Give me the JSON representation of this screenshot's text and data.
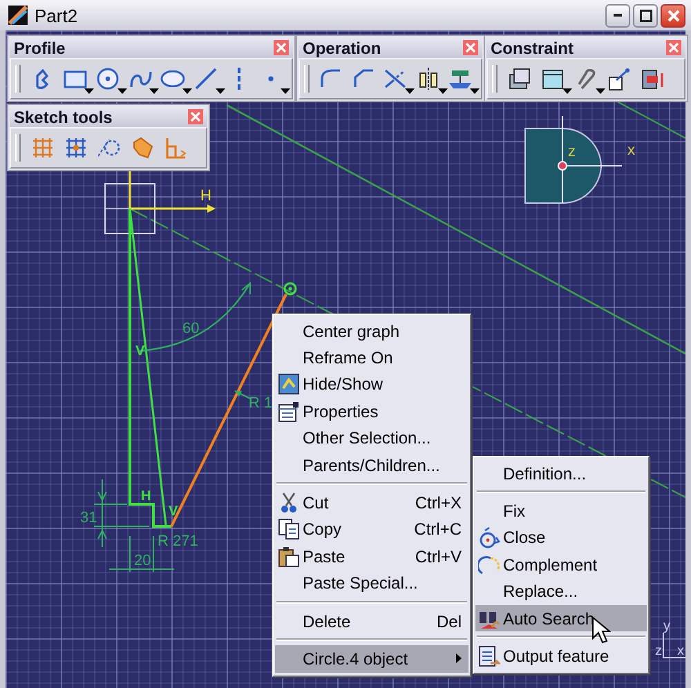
{
  "window": {
    "title": "Part2"
  },
  "toolbars": [
    {
      "title": "Profile",
      "tools": [
        {
          "dropdown": false
        },
        {
          "dropdown": true
        },
        {
          "dropdown": true
        },
        {
          "dropdown": true
        },
        {
          "dropdown": true
        },
        {
          "dropdown": true
        },
        {
          "dropdown": false
        },
        {
          "dropdown": true
        }
      ]
    },
    {
      "title": "Operation",
      "tools": [
        {
          "dropdown": false
        },
        {
          "dropdown": false
        },
        {
          "dropdown": true
        },
        {
          "dropdown": true
        },
        {
          "dropdown": true
        }
      ]
    },
    {
      "title": "Constraint",
      "tools": [
        {
          "dropdown": false
        },
        {
          "dropdown": true
        },
        {
          "dropdown": true
        },
        {
          "dropdown": false
        },
        {
          "dropdown": false
        }
      ]
    },
    {
      "title": "Sketch tools",
      "tools": [
        {
          "dropdown": false
        },
        {
          "dropdown": false
        },
        {
          "dropdown": false
        },
        {
          "dropdown": false
        },
        {
          "dropdown": false
        }
      ]
    }
  ],
  "sketch": {
    "h_axis_label": "H",
    "angle_dimension": "60",
    "radius_dimension": "R 1",
    "height_dimension": "31",
    "width_dimension": "20",
    "corner_radius_dimension": "R 271",
    "constraint_marks": [
      "V",
      "H",
      "V"
    ]
  },
  "compass": {
    "z_label": "z",
    "x_label": "x"
  },
  "axis_triad": {
    "y_label": "y",
    "z_label": "z",
    "x_label": "x"
  },
  "context_menu": {
    "items": [
      {
        "kind": "item",
        "label": "Center graph",
        "submenu": false,
        "selected": false
      },
      {
        "kind": "item",
        "label": "Reframe On",
        "submenu": false,
        "selected": false
      },
      {
        "kind": "item",
        "label": "Hide/Show",
        "submenu": false,
        "selected": false
      },
      {
        "kind": "item",
        "label": "Properties",
        "submenu": false,
        "selected": false
      },
      {
        "kind": "item",
        "label": "Other Selection...",
        "submenu": false,
        "selected": false
      },
      {
        "kind": "item",
        "label": "Parents/Children...",
        "submenu": false,
        "selected": false
      },
      {
        "kind": "separator"
      },
      {
        "kind": "item",
        "label": "Cut",
        "shortcut": "Ctrl+X",
        "submenu": false,
        "selected": false
      },
      {
        "kind": "item",
        "label": "Copy",
        "shortcut": "Ctrl+C",
        "submenu": false,
        "selected": false
      },
      {
        "kind": "item",
        "label": "Paste",
        "shortcut": "Ctrl+V",
        "submenu": false,
        "selected": false
      },
      {
        "kind": "item",
        "label": "Paste Special...",
        "submenu": false,
        "selected": false
      },
      {
        "kind": "separator"
      },
      {
        "kind": "item",
        "label": "Delete",
        "shortcut": "Del",
        "submenu": false,
        "selected": false
      },
      {
        "kind": "separator"
      },
      {
        "kind": "item",
        "label": "Circle.4 object",
        "submenu": true,
        "selected": true
      }
    ]
  },
  "submenu": {
    "items": [
      {
        "kind": "item",
        "label": "Definition...",
        "selected": false
      },
      {
        "kind": "separator"
      },
      {
        "kind": "item",
        "label": "Fix",
        "selected": false
      },
      {
        "kind": "item",
        "label": "Close",
        "selected": false
      },
      {
        "kind": "item",
        "label": "Complement",
        "selected": false
      },
      {
        "kind": "item",
        "label": "Replace...",
        "selected": false
      },
      {
        "kind": "item",
        "label": "Auto Search",
        "selected": true
      },
      {
        "kind": "separator"
      },
      {
        "kind": "item",
        "label": "Output feature",
        "selected": false
      }
    ]
  }
}
